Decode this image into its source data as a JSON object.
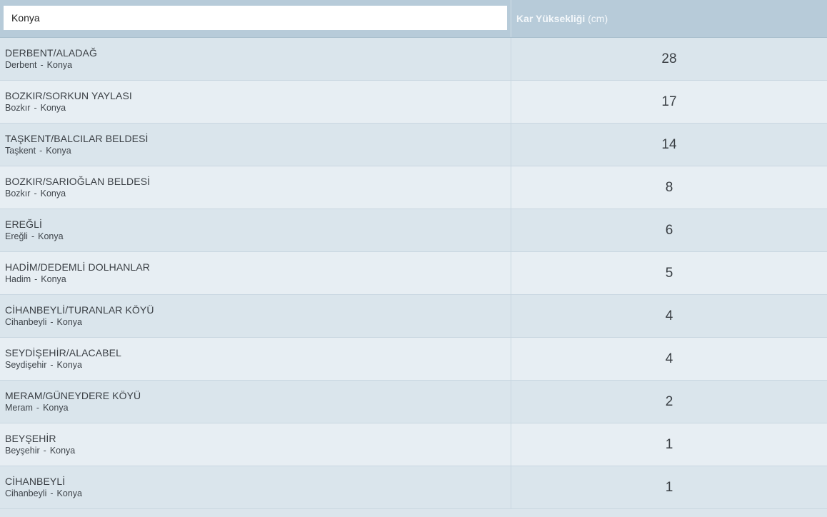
{
  "search": {
    "value": "Konya",
    "placeholder": ""
  },
  "header": {
    "column_label": "Kar Yüksekliği",
    "column_unit": "(cm)"
  },
  "region_separator": "-",
  "rows": [
    {
      "name": "DERBENT/ALADAĞ",
      "district": "Derbent",
      "province": "Konya",
      "snow_cm": "28"
    },
    {
      "name": "BOZKIR/SORKUN YAYLASI",
      "district": "Bozkır",
      "province": "Konya",
      "snow_cm": "17"
    },
    {
      "name": "TAŞKENT/BALCILAR BELDESİ",
      "district": "Taşkent",
      "province": "Konya",
      "snow_cm": "14"
    },
    {
      "name": "BOZKIR/SARIOĞLAN BELDESİ",
      "district": "Bozkır",
      "province": "Konya",
      "snow_cm": "8"
    },
    {
      "name": "EREĞLİ",
      "district": "Ereğli",
      "province": "Konya",
      "snow_cm": "6"
    },
    {
      "name": "HADİM/DEDEMLİ DOLHANLAR",
      "district": "Hadim",
      "province": "Konya",
      "snow_cm": "5"
    },
    {
      "name": "CİHANBEYLİ/TURANLAR KÖYÜ",
      "district": "Cihanbeyli",
      "province": "Konya",
      "snow_cm": "4"
    },
    {
      "name": "SEYDİŞEHİR/ALACABEL",
      "district": "Seydişehir",
      "province": "Konya",
      "snow_cm": "4"
    },
    {
      "name": "MERAM/GÜNEYDERE KÖYÜ",
      "district": "Meram",
      "province": "Konya",
      "snow_cm": "2"
    },
    {
      "name": "BEYŞEHİR",
      "district": "Beyşehir",
      "province": "Konya",
      "snow_cm": "1"
    },
    {
      "name": "CİHANBEYLİ",
      "district": "Cihanbeyli",
      "province": "Konya",
      "snow_cm": "1"
    }
  ]
}
